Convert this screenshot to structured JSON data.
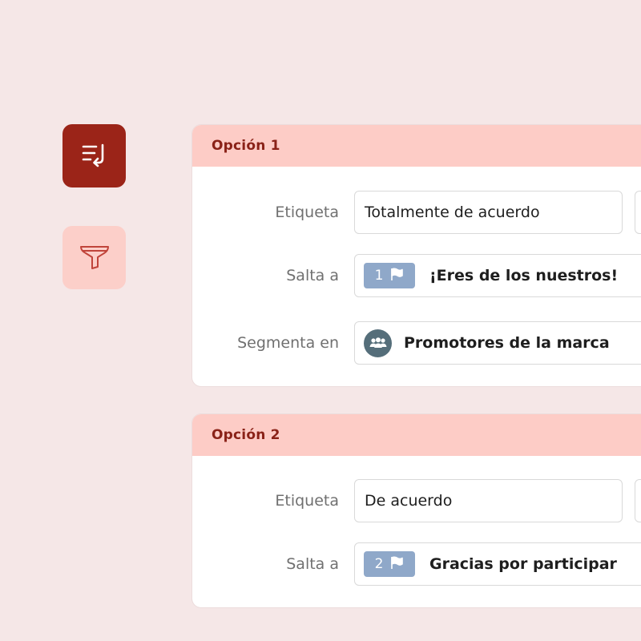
{
  "sidebar": {
    "items": [
      {
        "icon": "logic-jump-icon",
        "active": true
      },
      {
        "icon": "filter-icon",
        "active": false
      }
    ]
  },
  "options": [
    {
      "title": "Opción 1",
      "label_caption": "Etiqueta",
      "label_value": "Totalmente de acuerdo",
      "jump_caption": "Salta a",
      "jump_step": "1",
      "jump_target": "¡Eres de los nuestros!",
      "segment_caption": "Segmenta en",
      "segment_value": "Promotores de la marca"
    },
    {
      "title": "Opción 2",
      "label_caption": "Etiqueta",
      "label_value": "De acuerdo",
      "jump_caption": "Salta a",
      "jump_step": "2",
      "jump_target": "Gracias por participar"
    }
  ],
  "colors": {
    "background": "#f5e7e7",
    "accent_dark": "#9b2418",
    "accent_light": "#fccfc9",
    "header_text": "#8a2218",
    "step_badge": "#8fa8c9",
    "segment_avatar": "#556e7a"
  }
}
